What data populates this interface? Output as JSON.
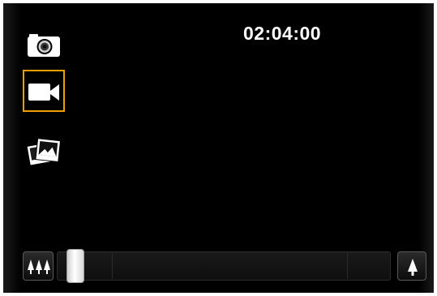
{
  "status": {
    "recording_time": "02:04:00"
  },
  "modes": [
    {
      "name": "camera",
      "icon": "camera-icon",
      "selected": false
    },
    {
      "name": "video",
      "icon": "video-camera-icon",
      "selected": true
    },
    {
      "name": "gallery",
      "icon": "gallery-icon",
      "selected": false
    }
  ],
  "zoom": {
    "level": 0.02,
    "zoom_out_icon": "trees-icon",
    "zoom_in_icon": "tree-icon"
  },
  "colors": {
    "background": "#000000",
    "selection": "#f0a000",
    "text": "#ffffff"
  }
}
